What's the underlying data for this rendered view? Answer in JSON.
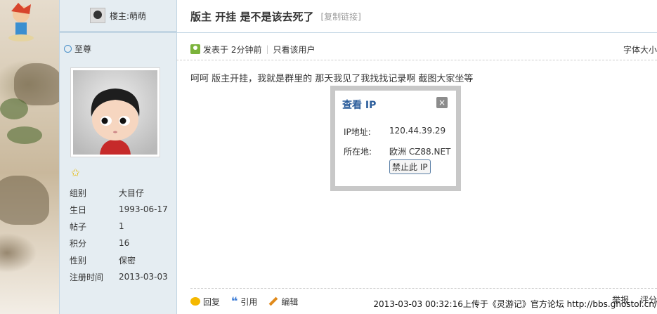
{
  "thread": {
    "title": "版主 开挂 是不是该去死了",
    "copy_link": "[复制链接]"
  },
  "author": {
    "header_label": "楼主:萌萌",
    "rank": "至尊",
    "profile": [
      {
        "label": "组别",
        "value": "大目仔"
      },
      {
        "label": "生日",
        "value": "1993-06-17"
      },
      {
        "label": "帖子",
        "value": "1"
      },
      {
        "label": "积分",
        "value": "16"
      },
      {
        "label": "性别",
        "value": "保密"
      },
      {
        "label": "注册时间",
        "value": "2013-03-03"
      }
    ]
  },
  "post_meta": {
    "posted": "发表于 2分钟前",
    "only_author": "只看该用户",
    "font_size": "字体大小"
  },
  "post": {
    "content": "呵呵  版主开挂，我就是群里的  那天我见了我找找记录啊  截图大家坐等"
  },
  "ip_dialog": {
    "title": "查看 IP",
    "close": "×",
    "ip_label": "IP地址:",
    "ip_value": "120.44.39.29",
    "loc_label": "所在地:",
    "loc_value": "欧洲 CZ88.NET",
    "ban_button": "禁止此 IP"
  },
  "actions": {
    "reply": "回复",
    "quote": "引用",
    "edit": "编辑",
    "report": "举报",
    "rate": "评分"
  },
  "footer": {
    "upload_text": "2013-03-03 00:32:16上传于《灵游记》官方论坛",
    "url": "http://bbs.gnostol.cn/"
  }
}
